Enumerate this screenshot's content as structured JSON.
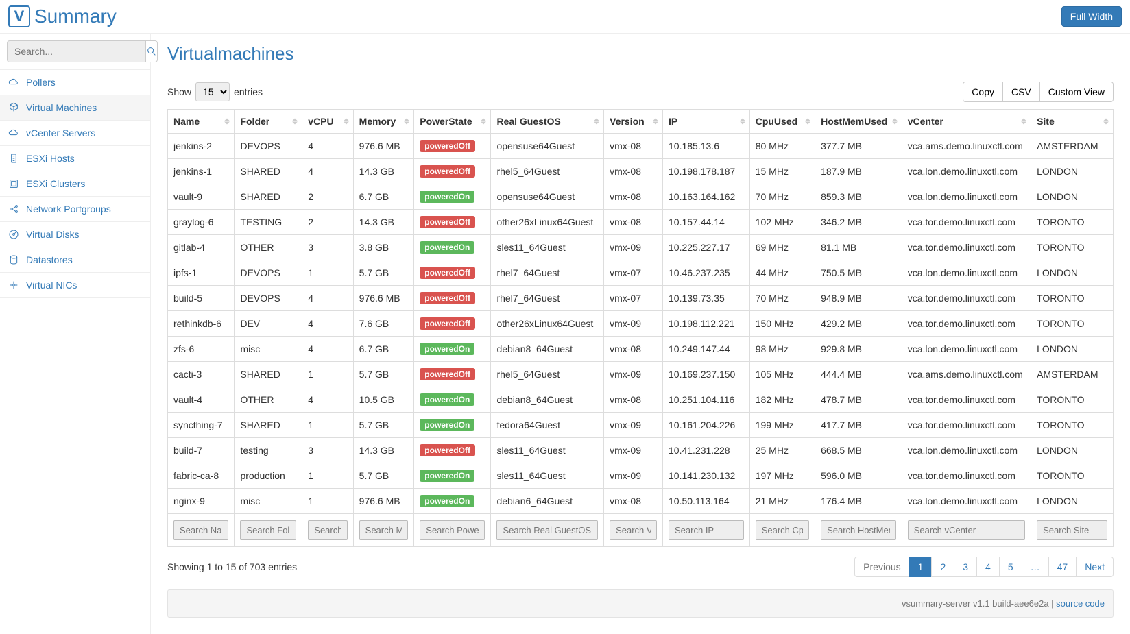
{
  "header": {
    "logo_text": "Summary",
    "full_width_label": "Full Width"
  },
  "search": {
    "placeholder": "Search..."
  },
  "sidebar": {
    "items": [
      {
        "label": "Pollers",
        "icon": "cloud"
      },
      {
        "label": "Virtual Machines",
        "icon": "cube",
        "active": true
      },
      {
        "label": "vCenter Servers",
        "icon": "cloud"
      },
      {
        "label": "ESXi Hosts",
        "icon": "server"
      },
      {
        "label": "ESXi Clusters",
        "icon": "hdd"
      },
      {
        "label": "Network Portgroups",
        "icon": "network"
      },
      {
        "label": "Virtual Disks",
        "icon": "disk"
      },
      {
        "label": "Datastores",
        "icon": "db"
      },
      {
        "label": "Virtual NICs",
        "icon": "nic"
      }
    ]
  },
  "page": {
    "title": "Virtualmachines"
  },
  "toolbar": {
    "show_label": "Show",
    "entries_label": "entries",
    "page_size": "15",
    "buttons": [
      "Copy",
      "CSV",
      "Custom View"
    ]
  },
  "table": {
    "columns": [
      {
        "key": "name",
        "header": "Name",
        "placeholder": "Search Name"
      },
      {
        "key": "folder",
        "header": "Folder",
        "placeholder": "Search Folder"
      },
      {
        "key": "vcpu",
        "header": "vCPU",
        "placeholder": "Search vCPU"
      },
      {
        "key": "memory",
        "header": "Memory",
        "placeholder": "Search Memory"
      },
      {
        "key": "power",
        "header": "PowerState",
        "placeholder": "Search PowerState"
      },
      {
        "key": "guestos",
        "header": "Real GuestOS",
        "placeholder": "Search Real GuestOS"
      },
      {
        "key": "version",
        "header": "Version",
        "placeholder": "Search Version"
      },
      {
        "key": "ip",
        "header": "IP",
        "placeholder": "Search IP"
      },
      {
        "key": "cpuused",
        "header": "CpuUsed",
        "placeholder": "Search CpuUsed"
      },
      {
        "key": "hostmem",
        "header": "HostMemUsed",
        "placeholder": "Search HostMemUsed"
      },
      {
        "key": "vcenter",
        "header": "vCenter",
        "placeholder": "Search vCenter"
      },
      {
        "key": "site",
        "header": "Site",
        "placeholder": "Search Site"
      }
    ],
    "rows": [
      {
        "name": "jenkins-2",
        "folder": "DEVOPS",
        "vcpu": "4",
        "memory": "976.6 MB",
        "power": "poweredOff",
        "guestos": "opensuse64Guest",
        "version": "vmx-08",
        "ip": "10.185.13.6",
        "cpuused": "80 MHz",
        "hostmem": "377.7 MB",
        "vcenter": "vca.ams.demo.linuxctl.com",
        "site": "AMSTERDAM"
      },
      {
        "name": "jenkins-1",
        "folder": "SHARED",
        "vcpu": "4",
        "memory": "14.3 GB",
        "power": "poweredOff",
        "guestos": "rhel5_64Guest",
        "version": "vmx-08",
        "ip": "10.198.178.187",
        "cpuused": "15 MHz",
        "hostmem": "187.9 MB",
        "vcenter": "vca.lon.demo.linuxctl.com",
        "site": "LONDON"
      },
      {
        "name": "vault-9",
        "folder": "SHARED",
        "vcpu": "2",
        "memory": "6.7 GB",
        "power": "poweredOn",
        "guestos": "opensuse64Guest",
        "version": "vmx-08",
        "ip": "10.163.164.162",
        "cpuused": "70 MHz",
        "hostmem": "859.3 MB",
        "vcenter": "vca.lon.demo.linuxctl.com",
        "site": "LONDON"
      },
      {
        "name": "graylog-6",
        "folder": "TESTING",
        "vcpu": "2",
        "memory": "14.3 GB",
        "power": "poweredOff",
        "guestos": "other26xLinux64Guest",
        "version": "vmx-08",
        "ip": "10.157.44.14",
        "cpuused": "102 MHz",
        "hostmem": "346.2 MB",
        "vcenter": "vca.tor.demo.linuxctl.com",
        "site": "TORONTO"
      },
      {
        "name": "gitlab-4",
        "folder": "OTHER",
        "vcpu": "3",
        "memory": "3.8 GB",
        "power": "poweredOn",
        "guestos": "sles11_64Guest",
        "version": "vmx-09",
        "ip": "10.225.227.17",
        "cpuused": "69 MHz",
        "hostmem": "81.1 MB",
        "vcenter": "vca.tor.demo.linuxctl.com",
        "site": "TORONTO"
      },
      {
        "name": "ipfs-1",
        "folder": "DEVOPS",
        "vcpu": "1",
        "memory": "5.7 GB",
        "power": "poweredOff",
        "guestos": "rhel7_64Guest",
        "version": "vmx-07",
        "ip": "10.46.237.235",
        "cpuused": "44 MHz",
        "hostmem": "750.5 MB",
        "vcenter": "vca.lon.demo.linuxctl.com",
        "site": "LONDON"
      },
      {
        "name": "build-5",
        "folder": "DEVOPS",
        "vcpu": "4",
        "memory": "976.6 MB",
        "power": "poweredOff",
        "guestos": "rhel7_64Guest",
        "version": "vmx-07",
        "ip": "10.139.73.35",
        "cpuused": "70 MHz",
        "hostmem": "948.9 MB",
        "vcenter": "vca.tor.demo.linuxctl.com",
        "site": "TORONTO"
      },
      {
        "name": "rethinkdb-6",
        "folder": "DEV",
        "vcpu": "4",
        "memory": "7.6 GB",
        "power": "poweredOff",
        "guestos": "other26xLinux64Guest",
        "version": "vmx-09",
        "ip": "10.198.112.221",
        "cpuused": "150 MHz",
        "hostmem": "429.2 MB",
        "vcenter": "vca.tor.demo.linuxctl.com",
        "site": "TORONTO"
      },
      {
        "name": "zfs-6",
        "folder": "misc",
        "vcpu": "4",
        "memory": "6.7 GB",
        "power": "poweredOn",
        "guestos": "debian8_64Guest",
        "version": "vmx-08",
        "ip": "10.249.147.44",
        "cpuused": "98 MHz",
        "hostmem": "929.8 MB",
        "vcenter": "vca.lon.demo.linuxctl.com",
        "site": "LONDON"
      },
      {
        "name": "cacti-3",
        "folder": "SHARED",
        "vcpu": "1",
        "memory": "5.7 GB",
        "power": "poweredOff",
        "guestos": "rhel5_64Guest",
        "version": "vmx-09",
        "ip": "10.169.237.150",
        "cpuused": "105 MHz",
        "hostmem": "444.4 MB",
        "vcenter": "vca.ams.demo.linuxctl.com",
        "site": "AMSTERDAM"
      },
      {
        "name": "vault-4",
        "folder": "OTHER",
        "vcpu": "4",
        "memory": "10.5 GB",
        "power": "poweredOn",
        "guestos": "debian8_64Guest",
        "version": "vmx-08",
        "ip": "10.251.104.116",
        "cpuused": "182 MHz",
        "hostmem": "478.7 MB",
        "vcenter": "vca.tor.demo.linuxctl.com",
        "site": "TORONTO"
      },
      {
        "name": "syncthing-7",
        "folder": "SHARED",
        "vcpu": "1",
        "memory": "5.7 GB",
        "power": "poweredOn",
        "guestos": "fedora64Guest",
        "version": "vmx-09",
        "ip": "10.161.204.226",
        "cpuused": "199 MHz",
        "hostmem": "417.7 MB",
        "vcenter": "vca.tor.demo.linuxctl.com",
        "site": "TORONTO"
      },
      {
        "name": "build-7",
        "folder": "testing",
        "vcpu": "3",
        "memory": "14.3 GB",
        "power": "poweredOff",
        "guestos": "sles11_64Guest",
        "version": "vmx-09",
        "ip": "10.41.231.228",
        "cpuused": "25 MHz",
        "hostmem": "668.5 MB",
        "vcenter": "vca.lon.demo.linuxctl.com",
        "site": "LONDON"
      },
      {
        "name": "fabric-ca-8",
        "folder": "production",
        "vcpu": "1",
        "memory": "5.7 GB",
        "power": "poweredOn",
        "guestos": "sles11_64Guest",
        "version": "vmx-09",
        "ip": "10.141.230.132",
        "cpuused": "197 MHz",
        "hostmem": "596.0 MB",
        "vcenter": "vca.tor.demo.linuxctl.com",
        "site": "TORONTO"
      },
      {
        "name": "nginx-9",
        "folder": "misc",
        "vcpu": "1",
        "memory": "976.6 MB",
        "power": "poweredOn",
        "guestos": "debian6_64Guest",
        "version": "vmx-08",
        "ip": "10.50.113.164",
        "cpuused": "21 MHz",
        "hostmem": "176.4 MB",
        "vcenter": "vca.lon.demo.linuxctl.com",
        "site": "LONDON"
      }
    ]
  },
  "pagination": {
    "info": "Showing 1 to 15 of 703 entries",
    "pages": [
      "Previous",
      "1",
      "2",
      "3",
      "4",
      "5",
      "…",
      "47",
      "Next"
    ],
    "active_index": 1,
    "disabled_index": 0
  },
  "footer": {
    "text": "vsummary-server v1.1 build-aee6e2a | ",
    "link": "source code"
  }
}
